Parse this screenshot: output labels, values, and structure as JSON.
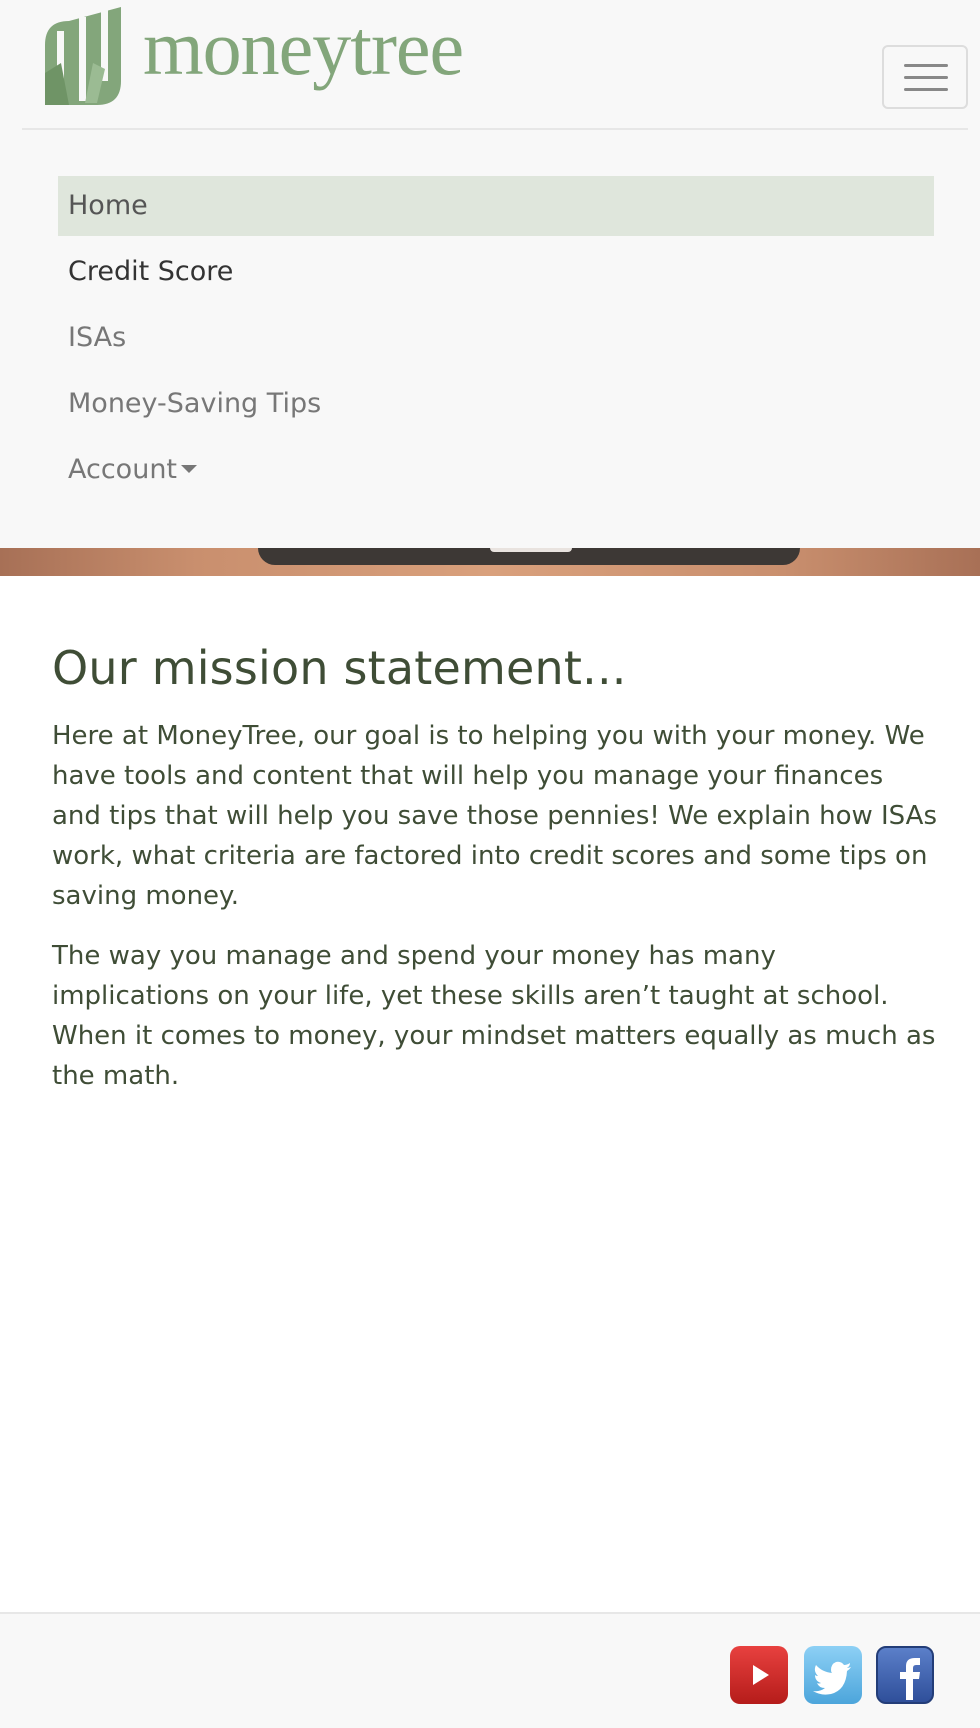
{
  "brand": {
    "name": "moneytree"
  },
  "navbar": {
    "toggle_icon": "hamburger-icon",
    "items": [
      {
        "label": "Home",
        "state": "active"
      },
      {
        "label": "Credit Score",
        "state": "focused"
      },
      {
        "label": "ISAs",
        "state": "default"
      },
      {
        "label": "Money-Saving Tips",
        "state": "default"
      },
      {
        "label": "Account",
        "state": "default",
        "icon": "caret-down-icon"
      }
    ]
  },
  "main": {
    "heading": "Our mission statement...",
    "paragraphs": [
      "Here at MoneyTree, our goal is to helping you with your money. We have tools and content that will help you manage your finances and tips that will help you save those pennies! We explain how ISAs work, what criteria are factored into credit scores and some tips on saving money.",
      "The way you manage and spend your money has many implications on your life, yet these skills aren’t taught at school. When it comes to money, your mindset matters equally as much as the math."
    ]
  },
  "footer": {
    "social": [
      {
        "name": "youtube-icon",
        "color": "#d52f2d"
      },
      {
        "name": "twitter-icon",
        "color": "#62b7e8"
      },
      {
        "name": "facebook-icon",
        "color": "#3b5ba8"
      }
    ]
  },
  "colors": {
    "brand_green": "#83a67b",
    "text_dark_green": "#3f4d36",
    "active_nav_bg": "#dfe6dc",
    "navbar_bg": "#f8f8f8"
  }
}
